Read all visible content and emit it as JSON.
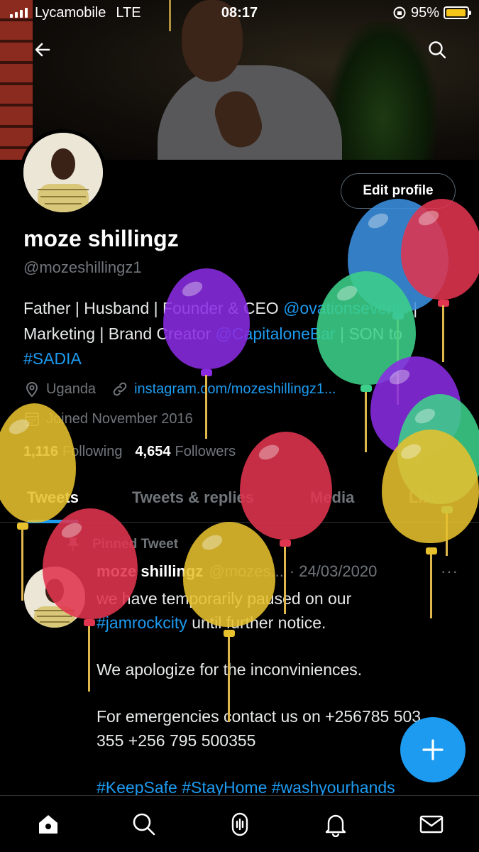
{
  "status_bar": {
    "carrier": "Lycamobile",
    "network": "LTE",
    "time": "08:17",
    "battery": "95%",
    "battery_level": 0.95
  },
  "profile": {
    "name": "moze shillingz",
    "handle": "@mozeshillingz1",
    "edit_label": "Edit profile",
    "bio": {
      "t1": "Father | Husband | Founder & CEO ",
      "l1": "@ovationsevents",
      "t2": " | Marketing | Brand Creator ",
      "l2": "@CapitaloneBar",
      "t3": " | SON to ",
      "l3": "#SADIA"
    },
    "location": "Uganda",
    "website": "instagram.com/mozeshillingz1...",
    "joined": "Joined November 2016",
    "following_count": "1,116",
    "following_label": "Following",
    "followers_count": "4,654",
    "followers_label": "Followers"
  },
  "tabs": [
    {
      "label": "Tweets"
    },
    {
      "label": "Tweets & replies"
    },
    {
      "label": "Media"
    },
    {
      "label": "Likes"
    }
  ],
  "tweet": {
    "pinned_label": "Pinned Tweet",
    "name": "moze shillingz",
    "handle": "@mozes...",
    "date": "· 24/03/2020",
    "more": "···",
    "line1": "we have temporarily paused on our",
    "hashtag1": "#jamrockcity",
    "line1b": " until further notice.",
    "line2": "We apologize for the inconviniences.",
    "line3": "For emergencies contact us on +256785 503 355 +256 795 500355",
    "hashtags": "#KeepSafe #StayHome #washyourhands"
  },
  "icons": {
    "back": "back-arrow-icon",
    "search": "search-icon",
    "compose": "plus-icon",
    "nav": [
      "home-icon",
      "search-icon",
      "spaces-icon",
      "notifications-icon",
      "messages-icon"
    ]
  },
  "colors": {
    "accent": "#1d9bf0",
    "background": "#000000",
    "muted": "#71767b",
    "balloon_purple": "#8a2be2",
    "balloon_blue": "#3b8fe0",
    "balloon_red": "#e0344f",
    "balloon_green": "#3cd08a",
    "balloon_yellow": "#e6c02d"
  }
}
